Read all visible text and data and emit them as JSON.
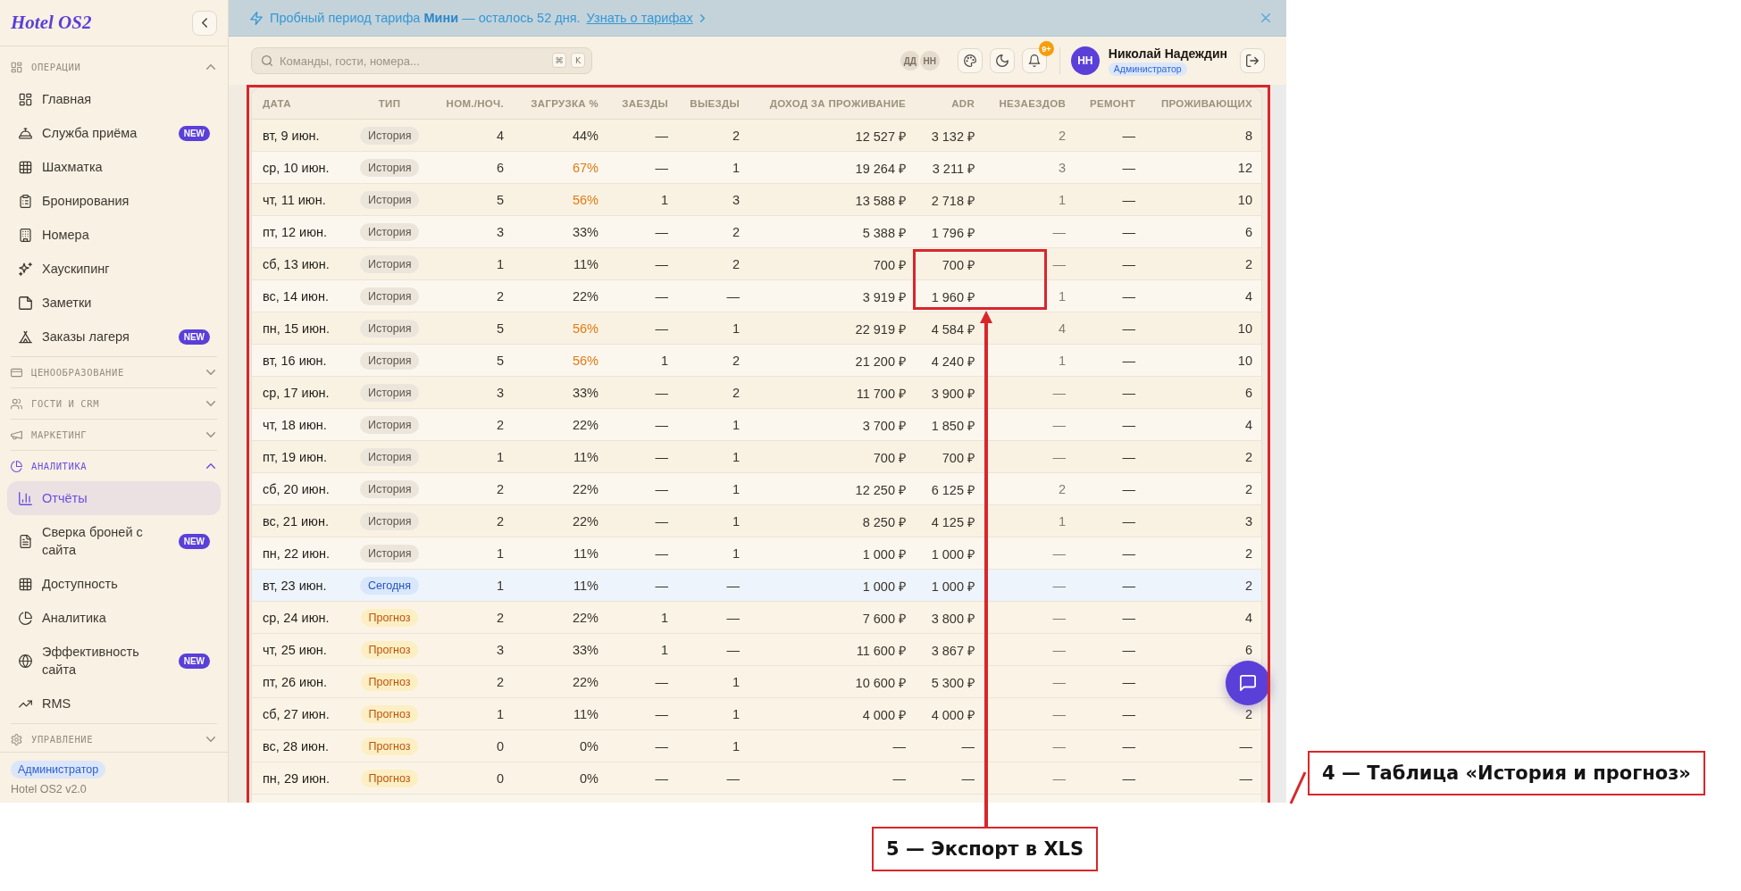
{
  "sidebar": {
    "logo": "Hotel OS2",
    "sections": [
      {
        "title": "ОПЕРАЦИИ",
        "expanded": true,
        "active": false,
        "items": [
          {
            "label": "Главная",
            "selected": false
          },
          {
            "label": "Служба приёма",
            "selected": false,
            "badge": "NEW"
          },
          {
            "label": "Шахматка",
            "selected": false
          },
          {
            "label": "Бронирования",
            "selected": false
          },
          {
            "label": "Номера",
            "selected": false
          },
          {
            "label": "Хаускипинг",
            "selected": false
          },
          {
            "label": "Заметки",
            "selected": false
          },
          {
            "label": "Заказы лагеря",
            "selected": false,
            "badge": "NEW"
          }
        ]
      },
      {
        "title": "ЦЕНООБРАЗОВАНИЕ",
        "expanded": false,
        "active": false
      },
      {
        "title": "ГОСТИ И CRM",
        "expanded": false,
        "active": false
      },
      {
        "title": "МАРКЕТИНГ",
        "expanded": false,
        "active": false
      },
      {
        "title": "АНАЛИТИКА",
        "expanded": true,
        "active": true,
        "items": [
          {
            "label": "Отчёты",
            "selected": true
          },
          {
            "label": "Сверка броней с сайта",
            "selected": false,
            "badge": "NEW"
          },
          {
            "label": "Доступность",
            "selected": false
          },
          {
            "label": "Аналитика",
            "selected": false
          },
          {
            "label": "Эффективность сайта",
            "selected": false,
            "badge": "NEW"
          },
          {
            "label": "RMS",
            "selected": false
          }
        ]
      },
      {
        "title": "УПРАВЛЕНИЕ",
        "expanded": false,
        "active": false
      }
    ],
    "footer": {
      "role": "Администратор",
      "version": "Hotel OS2 v2.0"
    }
  },
  "banner": {
    "message": "Пробный период тарифа **Мини** — осталось 52 дня.",
    "link": "Узнать о тарифах"
  },
  "header": {
    "search": {
      "placeholder": "Команды, гости, номера...",
      "keys": [
        "⌘",
        "K"
      ]
    },
    "presence": [
      "ДД",
      "НН"
    ],
    "notification_count": "9+",
    "user": {
      "initials": "НН",
      "name": "Николай Надеждин",
      "role": "Администратор"
    }
  },
  "table": {
    "columns": [
      "ДАТА",
      "ТИП",
      "НОМ./НОЧ.",
      "ЗАГРУЗКА %",
      "ЗАЕЗДЫ",
      "ВЫЕЗДЫ",
      "ДОХОД ЗА ПРОЖИВАНИЕ",
      "ADR",
      "НЕЗАЕЗДОВ",
      "РЕМОНТ",
      "ПРОЖИВАЮЩИХ"
    ],
    "rows": [
      {
        "date": "вт, 9 июн.",
        "type": {
          "label": "История",
          "kind": "history"
        },
        "nights": "4",
        "load": "44%",
        "load_high": false,
        "arrivals": "—",
        "departures": "2",
        "revenue": "12 527 ₽",
        "adr": "3 132 ₽",
        "no_shows": "2",
        "repairs": "—",
        "residents": "8"
      },
      {
        "date": "ср, 10 июн.",
        "type": {
          "label": "История",
          "kind": "history"
        },
        "nights": "6",
        "load": "67%",
        "load_high": true,
        "arrivals": "—",
        "departures": "1",
        "revenue": "19 264 ₽",
        "adr": "3 211 ₽",
        "no_shows": "3",
        "repairs": "—",
        "residents": "12"
      },
      {
        "date": "чт, 11 июн.",
        "type": {
          "label": "История",
          "kind": "history"
        },
        "nights": "5",
        "load": "56%",
        "load_high": true,
        "arrivals": "1",
        "departures": "3",
        "revenue": "13 588 ₽",
        "adr": "2 718 ₽",
        "no_shows": "1",
        "repairs": "—",
        "residents": "10"
      },
      {
        "date": "пт, 12 июн.",
        "type": {
          "label": "История",
          "kind": "history"
        },
        "nights": "3",
        "load": "33%",
        "load_high": false,
        "arrivals": "—",
        "departures": "2",
        "revenue": "5 388 ₽",
        "adr": "1 796 ₽",
        "no_shows": "—",
        "repairs": "—",
        "residents": "6"
      },
      {
        "date": "сб, 13 июн.",
        "type": {
          "label": "История",
          "kind": "history"
        },
        "nights": "1",
        "load": "11%",
        "load_high": false,
        "arrivals": "—",
        "departures": "2",
        "revenue": "700 ₽",
        "adr": "700 ₽",
        "no_shows": "—",
        "repairs": "—",
        "residents": "2"
      },
      {
        "date": "вс, 14 июн.",
        "type": {
          "label": "История",
          "kind": "history"
        },
        "nights": "2",
        "load": "22%",
        "load_high": false,
        "arrivals": "—",
        "departures": "—",
        "revenue": "3 919 ₽",
        "adr": "1 960 ₽",
        "no_shows": "1",
        "repairs": "—",
        "residents": "4"
      },
      {
        "date": "пн, 15 июн.",
        "type": {
          "label": "История",
          "kind": "history"
        },
        "nights": "5",
        "load": "56%",
        "load_high": true,
        "arrivals": "—",
        "departures": "1",
        "revenue": "22 919 ₽",
        "adr": "4 584 ₽",
        "no_shows": "4",
        "repairs": "—",
        "residents": "10"
      },
      {
        "date": "вт, 16 июн.",
        "type": {
          "label": "История",
          "kind": "history"
        },
        "nights": "5",
        "load": "56%",
        "load_high": true,
        "arrivals": "1",
        "departures": "2",
        "revenue": "21 200 ₽",
        "adr": "4 240 ₽",
        "no_shows": "1",
        "repairs": "—",
        "residents": "10"
      },
      {
        "date": "ср, 17 июн.",
        "type": {
          "label": "История",
          "kind": "history"
        },
        "nights": "3",
        "load": "33%",
        "load_high": false,
        "arrivals": "—",
        "departures": "2",
        "revenue": "11 700 ₽",
        "adr": "3 900 ₽",
        "no_shows": "—",
        "repairs": "—",
        "residents": "6"
      },
      {
        "date": "чт, 18 июн.",
        "type": {
          "label": "История",
          "kind": "history"
        },
        "nights": "2",
        "load": "22%",
        "load_high": false,
        "arrivals": "—",
        "departures": "1",
        "revenue": "3 700 ₽",
        "adr": "1 850 ₽",
        "no_shows": "—",
        "repairs": "—",
        "residents": "4"
      },
      {
        "date": "пт, 19 июн.",
        "type": {
          "label": "История",
          "kind": "history"
        },
        "nights": "1",
        "load": "11%",
        "load_high": false,
        "arrivals": "—",
        "departures": "1",
        "revenue": "700 ₽",
        "adr": "700 ₽",
        "no_shows": "—",
        "repairs": "—",
        "residents": "2"
      },
      {
        "date": "сб, 20 июн.",
        "type": {
          "label": "История",
          "kind": "history"
        },
        "nights": "2",
        "load": "22%",
        "load_high": false,
        "arrivals": "—",
        "departures": "1",
        "revenue": "12 250 ₽",
        "adr": "6 125 ₽",
        "no_shows": "2",
        "repairs": "—",
        "residents": "2"
      },
      {
        "date": "вс, 21 июн.",
        "type": {
          "label": "История",
          "kind": "history"
        },
        "nights": "2",
        "load": "22%",
        "load_high": false,
        "arrivals": "—",
        "departures": "1",
        "revenue": "8 250 ₽",
        "adr": "4 125 ₽",
        "no_shows": "1",
        "repairs": "—",
        "residents": "3"
      },
      {
        "date": "пн, 22 июн.",
        "type": {
          "label": "История",
          "kind": "history"
        },
        "nights": "1",
        "load": "11%",
        "load_high": false,
        "arrivals": "—",
        "departures": "1",
        "revenue": "1 000 ₽",
        "adr": "1 000 ₽",
        "no_shows": "—",
        "repairs": "—",
        "residents": "2"
      },
      {
        "date": "вт, 23 июн.",
        "type": {
          "label": "Сегодня",
          "kind": "today"
        },
        "nights": "1",
        "load": "11%",
        "load_high": false,
        "arrivals": "—",
        "departures": "—",
        "revenue": "1 000 ₽",
        "adr": "1 000 ₽",
        "no_shows": "—",
        "repairs": "—",
        "residents": "2"
      },
      {
        "date": "ср, 24 июн.",
        "type": {
          "label": "Прогноз",
          "kind": "forecast"
        },
        "nights": "2",
        "load": "22%",
        "load_high": false,
        "arrivals": "1",
        "departures": "—",
        "revenue": "7 600 ₽",
        "adr": "3 800 ₽",
        "no_shows": "—",
        "repairs": "—",
        "residents": "4"
      },
      {
        "date": "чт, 25 июн.",
        "type": {
          "label": "Прогноз",
          "kind": "forecast"
        },
        "nights": "3",
        "load": "33%",
        "load_high": false,
        "arrivals": "1",
        "departures": "—",
        "revenue": "11 600 ₽",
        "adr": "3 867 ₽",
        "no_shows": "—",
        "repairs": "—",
        "residents": "6"
      },
      {
        "date": "пт, 26 июн.",
        "type": {
          "label": "Прогноз",
          "kind": "forecast"
        },
        "nights": "2",
        "load": "22%",
        "load_high": false,
        "arrivals": "—",
        "departures": "1",
        "revenue": "10 600 ₽",
        "adr": "5 300 ₽",
        "no_shows": "—",
        "repairs": "—"
      },
      {
        "date": "сб, 27 июн.",
        "type": {
          "label": "Прогноз",
          "kind": "forecast"
        },
        "nights": "1",
        "load": "11%",
        "load_high": false,
        "arrivals": "—",
        "departures": "1",
        "revenue": "4 000 ₽",
        "adr": "4 000 ₽",
        "no_shows": "—",
        "repairs": "—",
        "residents": "2"
      },
      {
        "date": "вс, 28 июн.",
        "type": {
          "label": "Прогноз",
          "kind": "forecast"
        },
        "nights": "0",
        "load": "0%",
        "load_high": false,
        "arrivals": "—",
        "departures": "1",
        "revenue": "—",
        "adr": "—",
        "no_shows": "—",
        "repairs": "—",
        "residents": "—"
      },
      {
        "date": "пн, 29 июн.",
        "type": {
          "label": "Прогноз",
          "kind": "forecast"
        },
        "nights": "0",
        "load": "0%",
        "load_high": false,
        "arrivals": "—",
        "departures": "—",
        "revenue": "—",
        "adr": "—",
        "no_shows": "—",
        "repairs": "—",
        "residents": "—"
      }
    ]
  },
  "annotations": [
    {
      "label": "4 — Таблица «История и прогноз»"
    },
    {
      "label": "5 — Экспорт в XLS"
    }
  ]
}
